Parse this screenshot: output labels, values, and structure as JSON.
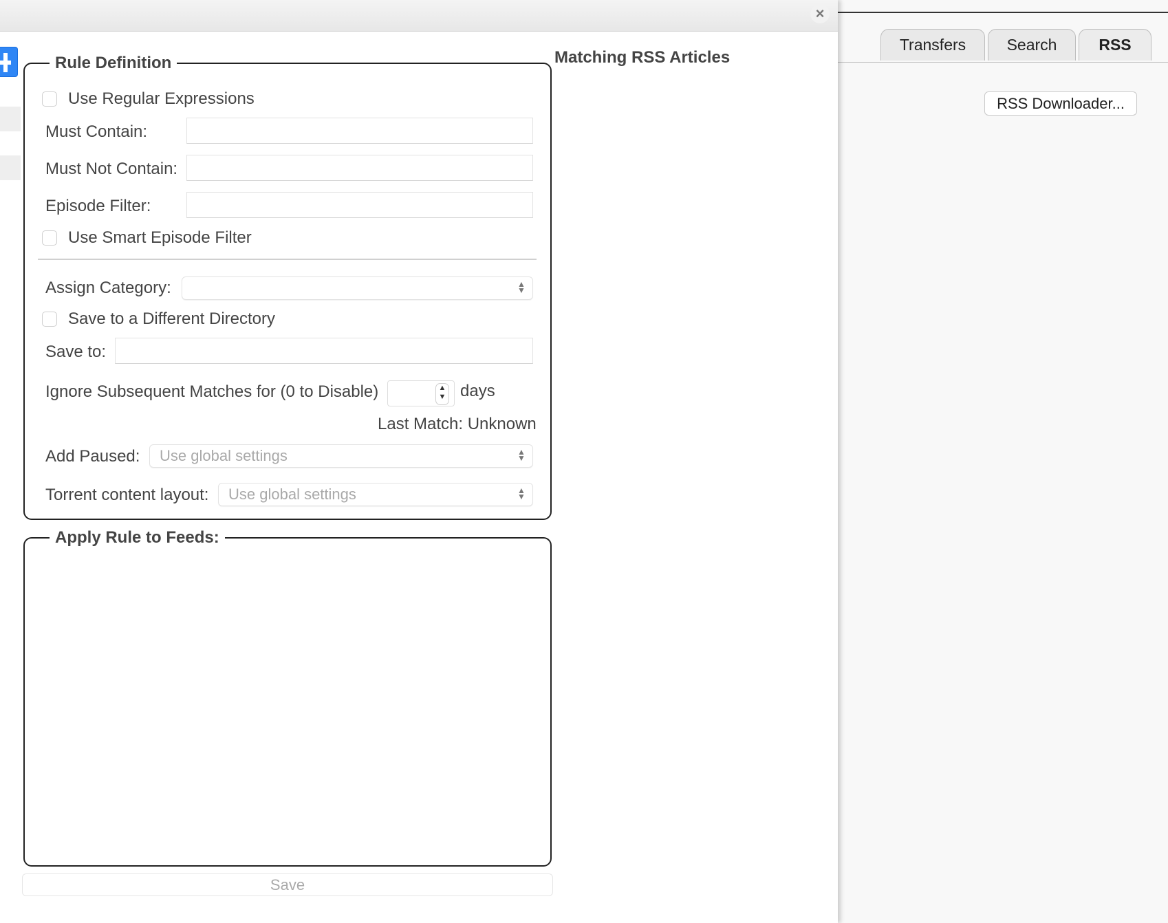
{
  "tabs": [
    {
      "label": "Transfers"
    },
    {
      "label": "Search"
    },
    {
      "label": "RSS",
      "active": true
    }
  ],
  "rss_downloader_button": "RSS Downloader...",
  "dialog": {
    "close_symbol": "×",
    "rule_definition": {
      "legend": "Rule Definition",
      "use_regex_label": "Use Regular Expressions",
      "must_contain_label": "Must Contain:",
      "must_not_contain_label": "Must Not Contain:",
      "episode_filter_label": "Episode Filter:",
      "smart_episode_label": "Use Smart Episode Filter",
      "assign_category_label": "Assign Category:",
      "assign_category_value": "",
      "save_different_dir_label": "Save to a Different Directory",
      "save_to_label": "Save to:",
      "ignore_matches_label": "Ignore Subsequent Matches for (0 to Disable)",
      "ignore_days_value": "",
      "days_label": "days",
      "last_match_label": "Last Match: Unknown",
      "add_paused_label": "Add Paused:",
      "add_paused_value": "Use global settings",
      "content_layout_label": "Torrent content layout:",
      "content_layout_value": "Use global settings"
    },
    "apply_feeds": {
      "legend": "Apply Rule to Feeds:"
    },
    "matching_articles_title": "Matching RSS Articles",
    "save_button": "Save"
  },
  "colors": {
    "accent_blue": "#2f86f5",
    "border": "#222222"
  }
}
